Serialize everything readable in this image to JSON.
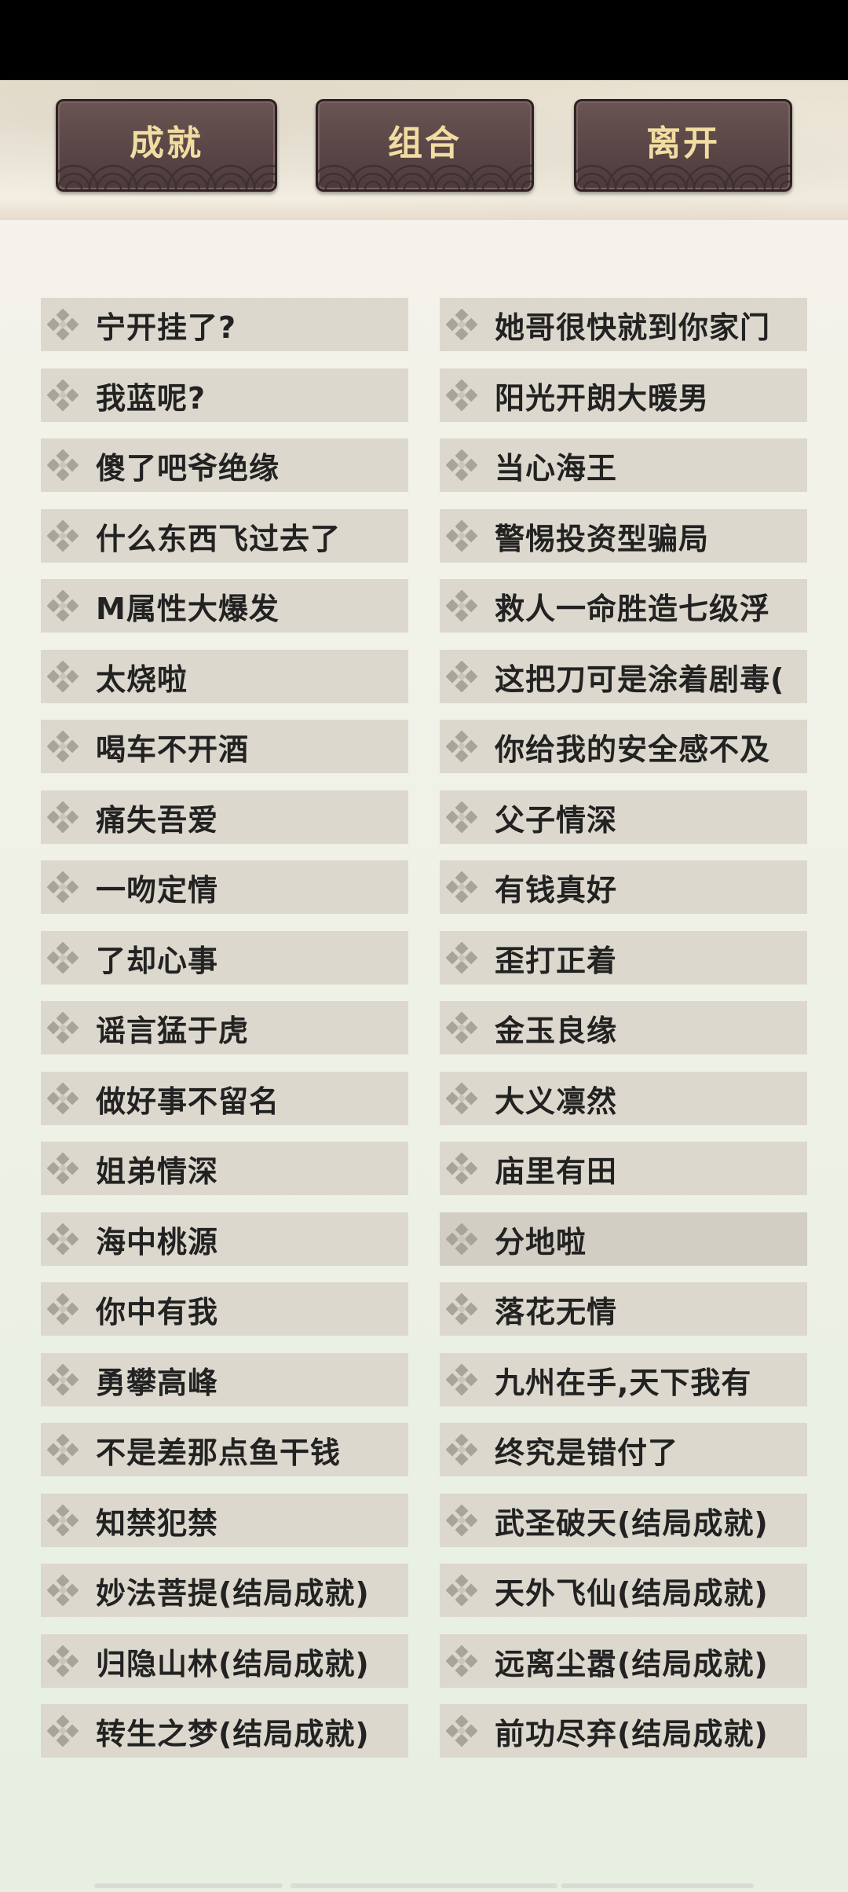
{
  "buttons": {
    "achievements": "成就",
    "combination": "组合",
    "leave": "离开"
  },
  "left_column": [
    "宁开挂了?",
    "我蓝呢?",
    "傻了吧爷绝缘",
    "什么东西飞过去了",
    "M属性大爆发",
    "太烧啦",
    "喝车不开酒",
    "痛失吾爱",
    "一吻定情",
    "了却心事",
    "谣言猛于虎",
    "做好事不留名",
    "姐弟情深",
    "海中桃源",
    "你中有我",
    "勇攀高峰",
    "不是差那点鱼干钱",
    "知禁犯禁",
    "妙法菩提(结局成就)",
    "归隐山林(结局成就)",
    "转生之梦(结局成就)"
  ],
  "right_column": [
    "她哥很快就到你家门",
    "阳光开朗大暖男",
    "当心海王",
    "警惕投资型骗局",
    "救人一命胜造七级浮",
    "这把刀可是涂着剧毒(",
    "你给我的安全感不及",
    "父子情深",
    "有钱真好",
    "歪打正着",
    "金玉良缘",
    "大义凛然",
    "庙里有田",
    "分地啦",
    "落花无情",
    "九州在手,天下我有",
    "终究是错付了",
    "武圣破天(结局成就)",
    "天外飞仙(结局成就)",
    "远离尘嚣(结局成就)",
    "前功尽弃(结局成就)"
  ],
  "icons": {
    "item_icon": "diamond-cluster-icon"
  },
  "colors": {
    "button_bg": "#5a4646",
    "button_text": "#f1dda1",
    "item_bg": "#dcd8cd"
  }
}
